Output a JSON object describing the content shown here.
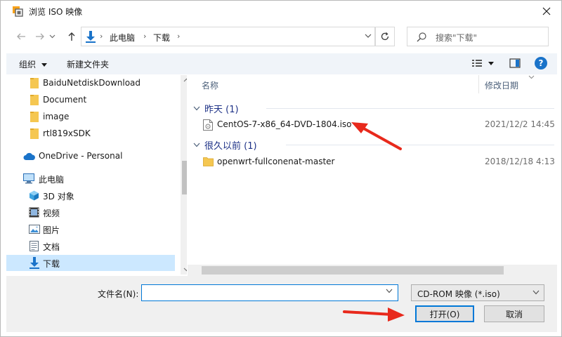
{
  "window": {
    "title": "浏览 ISO 映像"
  },
  "address": {
    "segments": [
      "此电脑",
      "下载"
    ]
  },
  "search": {
    "placeholder": "搜索\"下载\""
  },
  "toolbar": {
    "organize": "组织",
    "new_folder": "新建文件夹"
  },
  "nav": {
    "items": [
      {
        "label": "BaiduNetdiskDownload",
        "icon": "folder-icon"
      },
      {
        "label": "Document",
        "icon": "folder-icon"
      },
      {
        "label": "image",
        "icon": "folder-icon"
      },
      {
        "label": "rtl819xSDK",
        "icon": "folder-icon"
      },
      {
        "label": "OneDrive - Personal",
        "icon": "cloud-icon"
      },
      {
        "label": "此电脑",
        "icon": "computer-icon"
      },
      {
        "label": "3D 对象",
        "icon": "cube-icon"
      },
      {
        "label": "视频",
        "icon": "video-icon"
      },
      {
        "label": "图片",
        "icon": "picture-icon"
      },
      {
        "label": "文档",
        "icon": "document-icon"
      },
      {
        "label": "下载",
        "icon": "download-icon"
      }
    ],
    "selected": "下载"
  },
  "columns": {
    "name": "名称",
    "modified": "修改日期"
  },
  "groups": [
    {
      "label": "昨天 (1)",
      "files": [
        {
          "name": "CentOS-7-x86_64-DVD-1804.iso",
          "date": "2021/12/2 14:45",
          "icon": "disc-image-icon"
        }
      ]
    },
    {
      "label": "很久以前 (1)",
      "files": [
        {
          "name": "openwrt-fullconenat-master",
          "date": "2018/12/18 4:13",
          "icon": "folder-icon"
        }
      ]
    }
  ],
  "bottom": {
    "filename_label": "文件名(N):",
    "filename_value": "",
    "filter": "CD-ROM 映像 (*.iso)",
    "open": "打开(O)",
    "cancel": "取消"
  },
  "colors": {
    "accent": "#0078d7",
    "group_header": "#1e3287",
    "annotation_arrow": "#e8291c",
    "selection": "#cce8ff"
  }
}
